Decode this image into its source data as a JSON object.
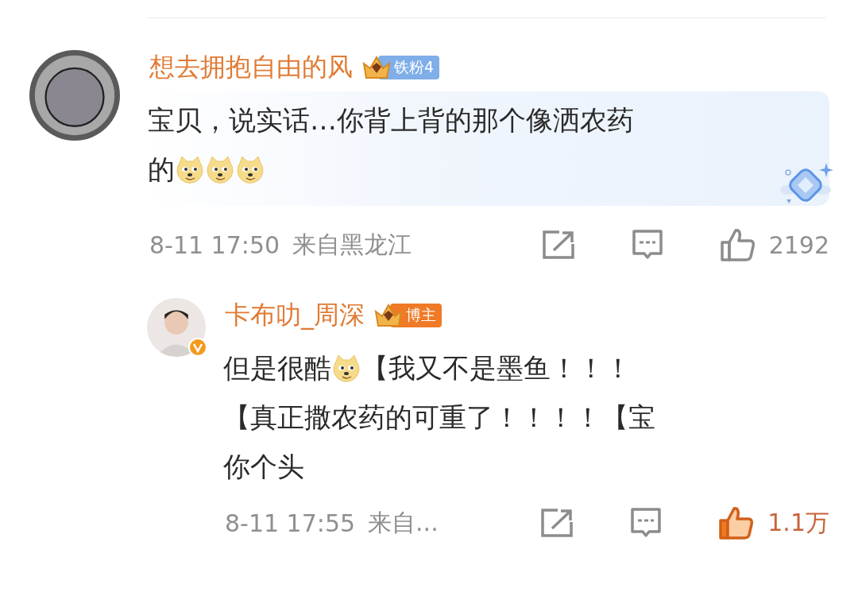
{
  "comments": [
    {
      "kind": "comment",
      "author": "想去拥抱自由的风",
      "badge": {
        "kind": "fan",
        "label": "铁粉4"
      },
      "highlighted": true,
      "lines": [
        [
          {
            "kind": "text",
            "text": "宝贝，说实话…你背上背的那个像洒农药"
          }
        ],
        [
          {
            "kind": "text",
            "text": "的"
          },
          {
            "kind": "emoji"
          },
          {
            "kind": "emoji"
          },
          {
            "kind": "emoji"
          }
        ]
      ],
      "time": "8-11 17:50",
      "location": "来自黑龙江",
      "likes": "2192",
      "liked": false,
      "verified": false
    },
    {
      "kind": "reply",
      "author": "卡布叻_周深",
      "badge": {
        "kind": "owner",
        "label": "博主"
      },
      "highlighted": false,
      "lines": [
        [
          {
            "kind": "text",
            "text": "但是很酷"
          },
          {
            "kind": "emoji"
          },
          {
            "kind": "text",
            "text": "【我又不是墨鱼！！！"
          }
        ],
        [
          {
            "kind": "text",
            "text": "【真正撒农药的可重了！！！！【宝"
          }
        ],
        [
          {
            "kind": "text",
            "text": "你个头"
          }
        ]
      ],
      "time": "8-11 17:55",
      "location": "来自...",
      "likes": "1.1万",
      "liked": true,
      "verified": true
    }
  ]
}
